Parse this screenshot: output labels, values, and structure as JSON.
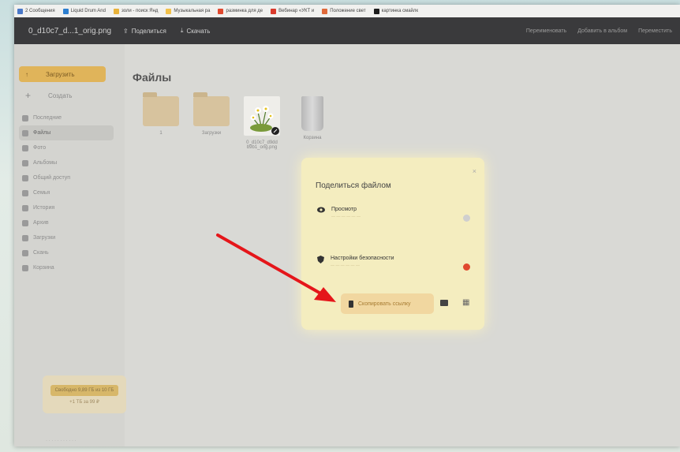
{
  "bookmarks": [
    {
      "label": "2 Сообщения",
      "color": "#4a78c8"
    },
    {
      "label": "Liquid Drum And",
      "color": "#2d7fd0"
    },
    {
      "label": "золи - поиск Янд",
      "color": "#e8b23a"
    },
    {
      "label": "Музыкальная ра",
      "color": "#f2c14a"
    },
    {
      "label": "разминка для де",
      "color": "#e0492f"
    },
    {
      "label": "Вебинар «УКТ и",
      "color": "#d93a2c"
    },
    {
      "label": "Положение свет",
      "color": "#e06a3a"
    },
    {
      "label": "картинка смайлк",
      "color": "#1d1d1d"
    }
  ],
  "topbar": {
    "file_name": "0_d10c7_d...1_orig.png",
    "share_label": "Поделиться",
    "download_label": "Скачать",
    "rename_label": "Переименовать",
    "add_album_label": "Добавить в альбом",
    "move_label": "Переместить"
  },
  "sidebar": {
    "upload_label": "Загрузить",
    "create_label": "Создать",
    "items": [
      {
        "label": "Последние",
        "active": false
      },
      {
        "label": "Файлы",
        "active": true
      },
      {
        "label": "Фото",
        "active": false
      },
      {
        "label": "Альбомы",
        "active": false
      },
      {
        "label": "Общий доступ",
        "active": false
      },
      {
        "label": "Семья",
        "active": false
      },
      {
        "label": "История",
        "active": false
      },
      {
        "label": "Архив",
        "active": false
      },
      {
        "label": "Загрузки",
        "active": false
      },
      {
        "label": "Скань",
        "active": false
      },
      {
        "label": "Корзина",
        "active": false
      }
    ],
    "storage_text": "Свободно 9,89 ГБ из 10 ГБ",
    "buy_label": "+1 ТБ за 99 ₽"
  },
  "main": {
    "title": "Файлы",
    "files": [
      {
        "name": "1",
        "kind": "folder"
      },
      {
        "name": "Загрузки",
        "kind": "folder"
      },
      {
        "name": "0_d10c7_d9dd b9b1_orig.png",
        "kind": "image"
      },
      {
        "name": "Корзина",
        "kind": "trash"
      }
    ]
  },
  "dialog": {
    "title": "Поделиться файлом",
    "close_label": "×",
    "view_label": "Просмотр",
    "security_label": "Настройки безопасности",
    "copy_link_label": "Скопировать ссылку",
    "accent_color": "#e0492f"
  }
}
